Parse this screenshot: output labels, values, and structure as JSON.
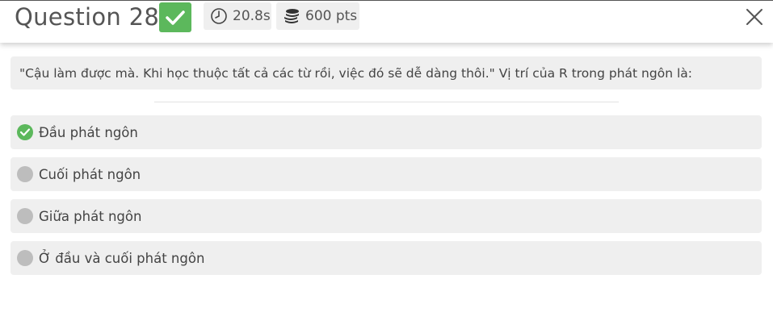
{
  "header": {
    "question_title": "Question 28",
    "status_icon": "check-icon",
    "timer": {
      "icon": "clock-icon",
      "value": "20.8s"
    },
    "points": {
      "icon": "coins-icon",
      "value": "600 pts"
    },
    "close_icon": "close-icon"
  },
  "question": {
    "text": "\"Cậu làm được mà. Khi học thuộc tất cả các từ rồi, việc đó sẽ dễ dàng thôi.\" Vị trí của R trong phát ngôn là:"
  },
  "options": [
    {
      "label": "Đầu phát ngôn",
      "state": "correct"
    },
    {
      "label": "Cuối phát ngôn",
      "state": "unselected"
    },
    {
      "label": "Giữa phát ngôn",
      "state": "unselected"
    },
    {
      "label": "Ở đầu và cuối phát ngôn",
      "state": "unselected"
    }
  ],
  "colors": {
    "correct": "#5cb85c",
    "unselected": "#bdbdbd",
    "panel": "#efefef"
  }
}
